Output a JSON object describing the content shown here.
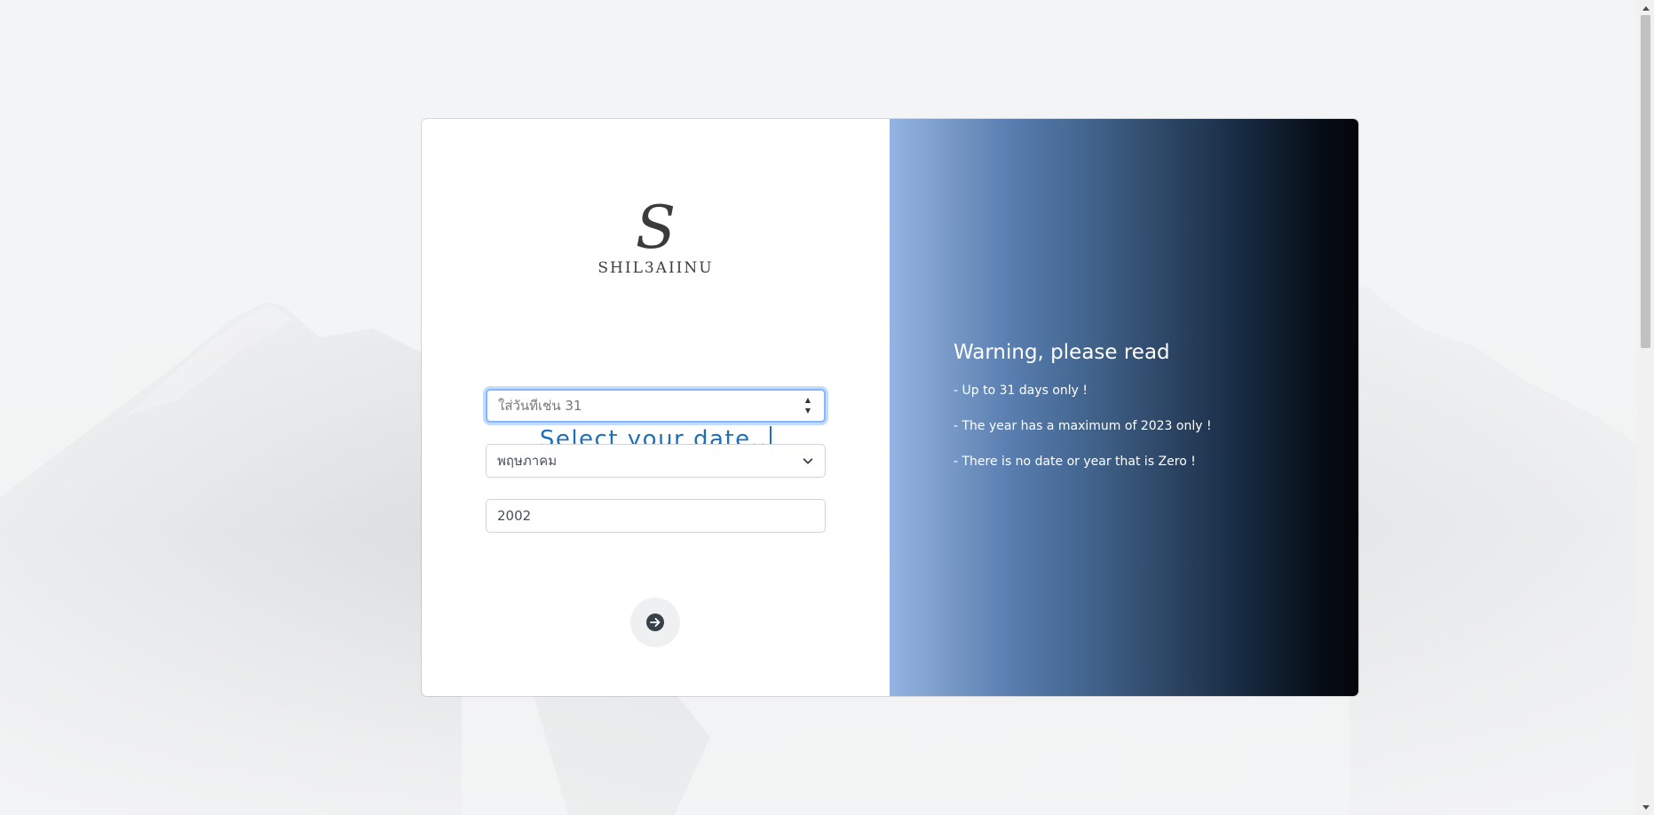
{
  "brand": {
    "logo_mark": "S",
    "logo_text": "SHIL3AIINU"
  },
  "form": {
    "headline": "Select your date..",
    "day": {
      "value": "",
      "placeholder": "ใส่วันที่เช่น 31"
    },
    "month": {
      "selected": "พฤษภาคม"
    },
    "year": {
      "value": "2002"
    },
    "submit_icon": "arrow-right-circle-icon"
  },
  "warning": {
    "title": "Warning, please read",
    "lines": [
      "- Up to 31 days only !",
      "- The year has a maximum of 2023 only !",
      "- There is no date or year that is Zero !"
    ]
  },
  "colors": {
    "headline": "#1f6fb8",
    "gradient_start": "#93b4e2",
    "gradient_end": "#03060b",
    "focus_ring": "#86b7fe"
  }
}
